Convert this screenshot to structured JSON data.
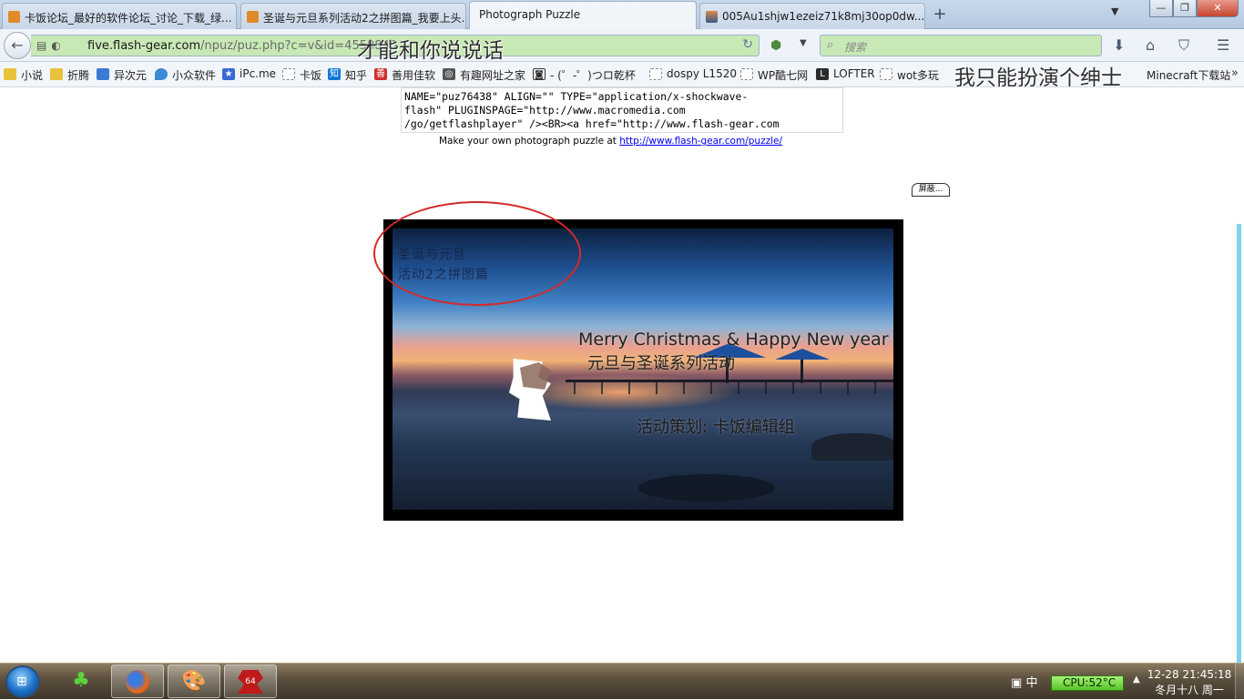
{
  "tabs": [
    {
      "label": "卡饭论坛_最好的软件论坛_讨论_下载_绿...",
      "fav_color": "#e08a2a"
    },
    {
      "label": "圣诞与元旦系列活动2之拼图篇_我要上头...",
      "fav_color": "#e08a2a"
    },
    {
      "label": "Photograph Puzzle",
      "active": true
    },
    {
      "label": "005Au1shjw1ezeiz71k8mj30op0dw...",
      "fav_color": "#4b6ea8"
    }
  ],
  "tab_new": "+",
  "tab_list": "▼",
  "window_buttons": {
    "minimize": "—",
    "maximize": "❐",
    "close": "✕"
  },
  "nav": {
    "back": "←",
    "url_host": "five.flash-gear.com",
    "url_path": "/npuz/puz.php?c=v&id=4558840",
    "reload": "↻",
    "search_placeholder": "搜索",
    "icons": [
      "download-icon",
      "home-icon",
      "pocket-icon",
      "menu-icon"
    ]
  },
  "bookmarks": [
    {
      "label": "小说",
      "icon_color": "#e8c23a"
    },
    {
      "label": "折腾",
      "icon_color": "#e8c23a"
    },
    {
      "label": "异次元",
      "icon_color": "#3a7bd5"
    },
    {
      "label": "小众软件",
      "icon_color": "#3a8ad5"
    },
    {
      "label": "iPc.me",
      "icon_color": "#3a6ad5"
    },
    {
      "label": "卡饭",
      "icon_color": "#bbbbbb"
    },
    {
      "label": "知乎",
      "icon_color": "#0f77d8",
      "glyph": "知"
    },
    {
      "label": "善用佳软",
      "icon_color": "#d12d2d"
    },
    {
      "label": "有趣网址之家",
      "icon_color": "#555555"
    },
    {
      "label": "- (゜-゜)つロ乾杯",
      "icon_color": "#333333"
    },
    {
      "label": "dospy L1520",
      "icon_color": "#bbbbbb"
    },
    {
      "label": "WP酷七网",
      "icon_color": "#bbbbbb"
    },
    {
      "label": "LOFTER",
      "icon_color": "#2a2a2a",
      "glyph": "L"
    },
    {
      "label": "wot多玩",
      "icon_color": "#bbbbbb"
    },
    {
      "label": "Minecraft下载站",
      "icon_color": "#bbbbbb"
    }
  ],
  "bookmarks_more": "»",
  "overlay": {
    "center": "才能和你说说话",
    "right": "我只能扮演个绅士"
  },
  "page": {
    "code_lines": [
      "NAME=\"puz76438\" ALIGN=\"\" TYPE=\"application/x-shockwave-",
      "flash\" PLUGINSPAGE=\"http://www.macromedia.com",
      "/go/getflashplayer\" /><BR><a href=\"http://www.flash-gear.com"
    ],
    "make_own_text": "Make your own photograph puzzle at",
    "make_own_link": "http://www.flash-gear.com/puzzle/",
    "screen_button": "屏蔽..."
  },
  "puzzle": {
    "ghost_line1": "圣诞与元旦",
    "ghost_line2": "活动2之拼图篇",
    "title_en": "Merry Christmas & Happy New year",
    "title_cn": "元旦与圣诞系列活动",
    "credit": "活动策划: 卡饭编辑组"
  },
  "taskbar": {
    "apps": [
      "clover-icon",
      "firefox-icon",
      "paint-icon",
      "puzzle-64-icon"
    ],
    "badge_64": "64",
    "ime": "中",
    "cpu": "CPU:52°C",
    "tray_arrow": "▲",
    "time_line": "12-28  21:45:18",
    "date_line": "冬月十八 周一"
  }
}
